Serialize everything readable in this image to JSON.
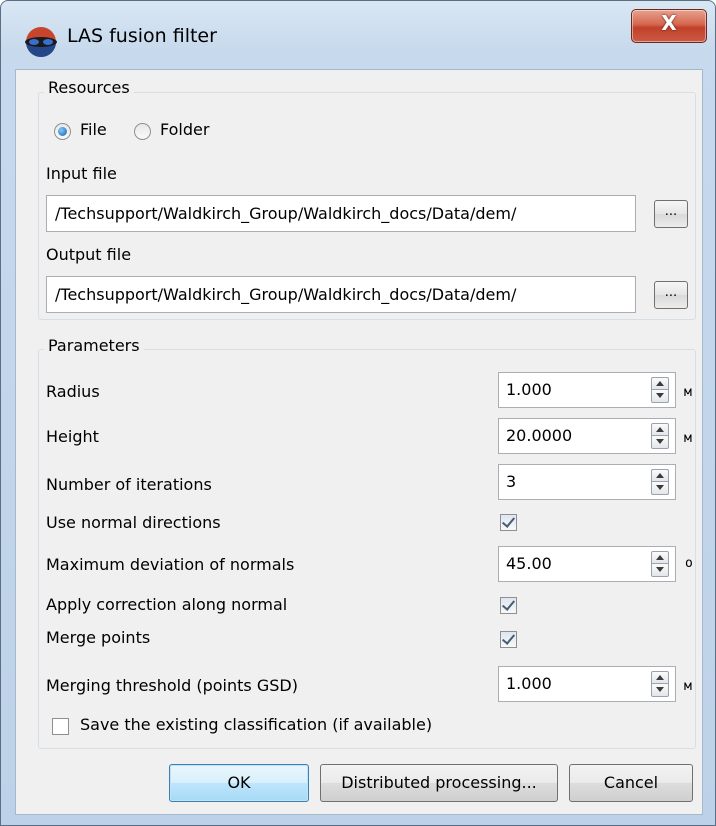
{
  "window": {
    "title": "LAS fusion filter",
    "close_label": "X"
  },
  "resources": {
    "title": "Resources",
    "mode_file_label": "File",
    "mode_folder_label": "Folder",
    "selected_mode": "File",
    "input_label": "Input file",
    "input_value": "/Techsupport/Waldkirch_Group/Waldkirch_docs/Data/dem/",
    "output_label": "Output file",
    "output_value": "/Techsupport/Waldkirch_Group/Waldkirch_docs/Data/dem/",
    "browse_label": "..."
  },
  "parameters": {
    "title": "Parameters",
    "radius": {
      "label": "Radius",
      "value": "1.000",
      "unit": "м"
    },
    "height": {
      "label": "Height",
      "value": "20.0000",
      "unit": "м"
    },
    "iterations": {
      "label": "Number of iterations",
      "value": "3"
    },
    "use_normals": {
      "label": "Use normal directions",
      "checked": true
    },
    "max_deviation": {
      "label": "Maximum deviation of normals",
      "value": "45.00",
      "unit": "o"
    },
    "apply_correction": {
      "label": "Apply correction along normal",
      "checked": true
    },
    "merge_points": {
      "label": "Merge points",
      "checked": true
    },
    "merge_threshold": {
      "label": "Merging threshold (points GSD)",
      "value": "1.000",
      "unit": "м"
    }
  },
  "save_classification": {
    "label": "Save the existing classification (if available)",
    "checked": false
  },
  "buttons": {
    "ok": "OK",
    "distributed": "Distributed processing...",
    "cancel": "Cancel"
  }
}
